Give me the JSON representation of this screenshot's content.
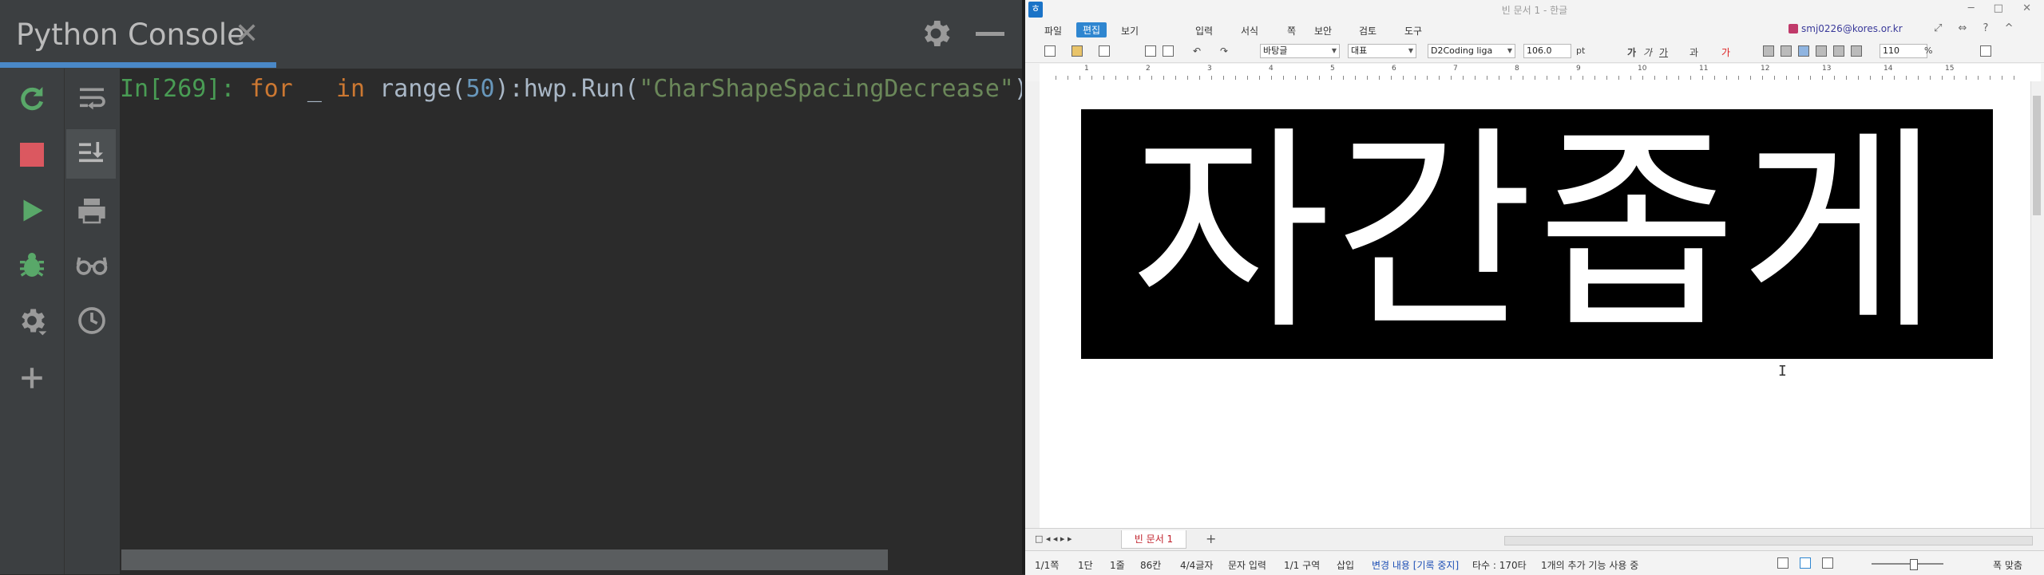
{
  "console": {
    "title": "Python Console",
    "close_glyph": "✕",
    "input": {
      "prompt": "In[269]:",
      "kw_for": "for",
      "var": "_",
      "kw_in": "in",
      "func": "range(",
      "number": "50",
      "rest": "):hwp.Run(",
      "string": "\"CharShapeSpacingDecrease\"",
      "close": ")"
    },
    "toolbar_icons": [
      "rerun-icon",
      "stop-icon",
      "run-icon",
      "debug-icon",
      "settings-icon",
      "add-icon"
    ],
    "toolbar2_icons": [
      "soft-wrap-icon",
      "scroll-to-end-icon",
      "print-icon",
      "show-variables-icon",
      "history-icon"
    ]
  },
  "hwp": {
    "window_title": "빈 문서 1 - 한글",
    "logo": "ㅎ",
    "menus": [
      "파일",
      "편집",
      "보기",
      "입력",
      "서식",
      "쪽",
      "보안",
      "검토",
      "도구"
    ],
    "active_menu": "편집",
    "user": "smj0226@kores.or.kr",
    "toolbar": {
      "style": "바탕글",
      "language": "대표",
      "font": "D2Coding liga",
      "size": "106.0",
      "size_unit": "pt",
      "zoom": "110",
      "zoom_unit": "%",
      "bold_glyph": "가",
      "italic_glyph": "가",
      "underline_glyph": "가",
      "strike_glyph": "과",
      "color_glyph": "가"
    },
    "ruler_numbers": [
      "1",
      "2",
      "3",
      "4",
      "5",
      "6",
      "7",
      "8",
      "9",
      "10",
      "11",
      "12",
      "13",
      "14",
      "15"
    ],
    "document_text": "자간좁게",
    "doc_tab": "빈 문서 1",
    "status": {
      "page": "1/1쪽",
      "column": "1단",
      "line": "1줄",
      "col": "86칸",
      "chars": "4/4글자",
      "input_mode": "문자 입력",
      "section": "1/1 구역",
      "insert": "삽입",
      "track": "변경 내용 [기록 중지]",
      "typing": "타수 : 170타",
      "extra": "1개의 추가 기능 사용 중",
      "fit": "폭 맞춤"
    },
    "colors": {
      "accent": "#2f86d0",
      "doc_bg": "#000000",
      "doc_text": "#ffffff"
    }
  }
}
